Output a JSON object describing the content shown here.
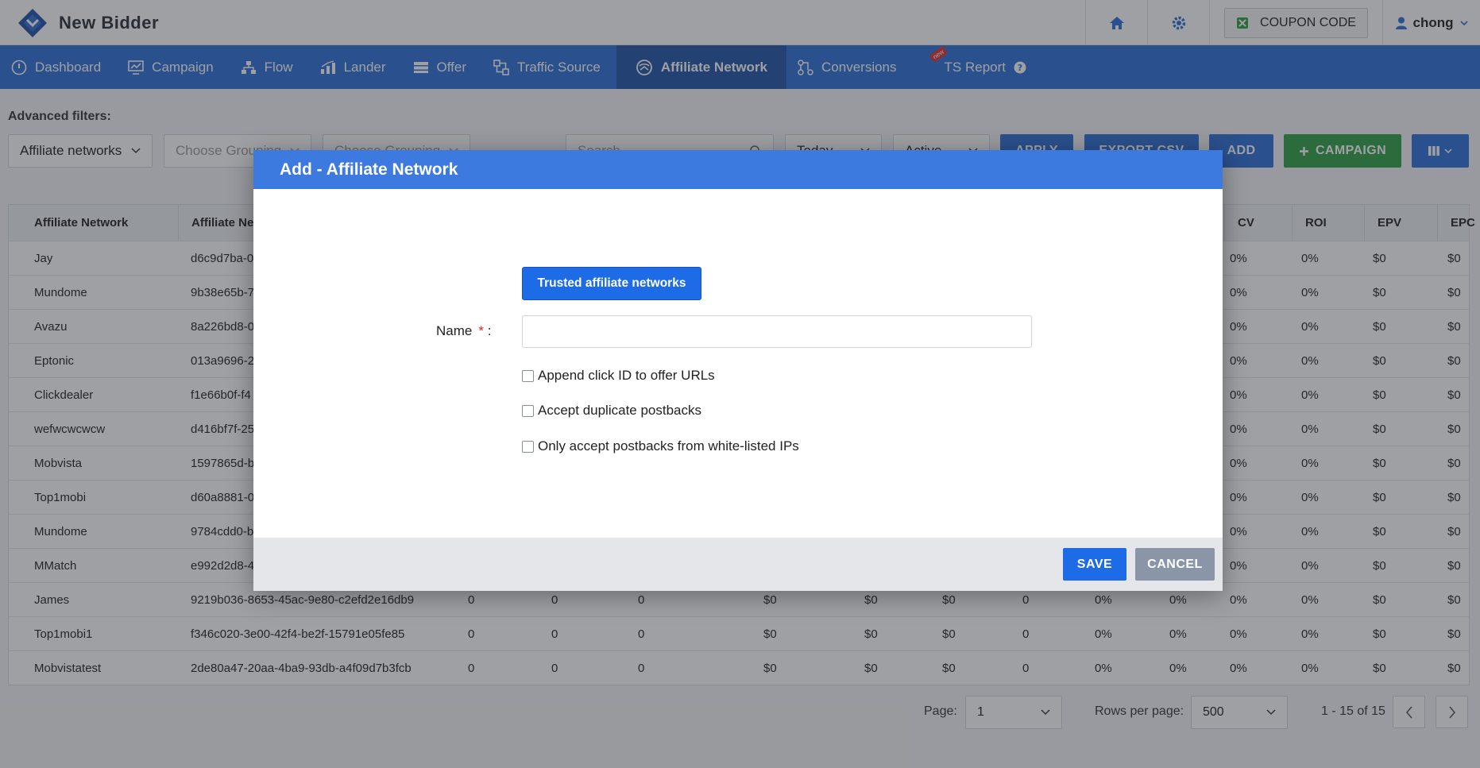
{
  "app": {
    "name": "New Bidder"
  },
  "header": {
    "coupon_label": "COUPON CODE",
    "user_name": "chong"
  },
  "nav": {
    "items": [
      {
        "label": "Dashboard"
      },
      {
        "label": "Campaign"
      },
      {
        "label": "Flow"
      },
      {
        "label": "Lander"
      },
      {
        "label": "Offer"
      },
      {
        "label": "Traffic Source"
      },
      {
        "label": "Affiliate Network"
      },
      {
        "label": "Conversions"
      },
      {
        "label": "TS Report"
      }
    ],
    "active_index": 6,
    "new_badge": "new"
  },
  "filters": {
    "label": "Advanced filters:",
    "group1": "Affiliate networks",
    "group2_placeholder": "Choose Grouping",
    "group3_placeholder": "Choose Grouping",
    "search_placeholder": "Search",
    "date_range": "Today",
    "status": "Active",
    "apply_label": "APPLY",
    "export_label": "EXPORT CSV",
    "add_label": "ADD",
    "campaign_label": "CAMPAIGN"
  },
  "table": {
    "headers": [
      "Affiliate Network",
      "Affiliate Ne",
      "CV",
      "ROI",
      "EPV",
      "EPC"
    ],
    "rows": [
      {
        "name": "Jay",
        "id": "d6c9d7ba-0"
      },
      {
        "name": "Mundome",
        "id": "9b38e65b-7"
      },
      {
        "name": "Avazu",
        "id": "8a226bd8-0"
      },
      {
        "name": "Eptonic",
        "id": "013a9696-2"
      },
      {
        "name": "Clickdealer",
        "id": "f1e66b0f-f4"
      },
      {
        "name": "wefwcwcwcw",
        "id": "d416bf7f-25"
      },
      {
        "name": "Mobvista",
        "id": "1597865d-b"
      },
      {
        "name": "Top1mobi",
        "id": "d60a8881-0"
      },
      {
        "name": "Mundome",
        "id": "9784cdd0-b"
      },
      {
        "name": "MMatch",
        "id": "e992d2d8-4"
      },
      {
        "name": "James",
        "id": "9219b036-8653-45ac-9e80-c2efd2e16db9"
      },
      {
        "name": "Top1mobi1",
        "id": "f346c020-3e00-42f4-be2f-15791e05fe85"
      },
      {
        "name": "Mobvistatest",
        "id": "2de80a47-20aa-4ba9-93db-a4f09d7b3fcb"
      }
    ],
    "full_row_values": [
      "0",
      "0",
      "0",
      "$0",
      "$0",
      "$0",
      "0",
      "0%",
      "0%"
    ],
    "tail_values": [
      "0%",
      "0%",
      "$0",
      "$0"
    ]
  },
  "pagination": {
    "page_label": "Page:",
    "page_value": "1",
    "rows_label": "Rows per page:",
    "rows_value": "500",
    "range_text": "1 - 15 of 15"
  },
  "modal": {
    "title": "Add - Affiliate Network",
    "trusted_label": "Trusted affiliate networks",
    "name_label": "Name",
    "required_mark": "*",
    "name_colon": ":",
    "name_value": "",
    "check1": "Append click ID to offer URLs",
    "check2": "Accept duplicate postbacks",
    "check3": "Only accept postbacks from white-listed IPs",
    "save_label": "SAVE",
    "cancel_label": "CANCEL"
  },
  "colors": {
    "nav_blue": "#2c6ed8",
    "nav_active": "#1f52a8",
    "modal_header": "#3d7ae0",
    "primary_button": "#1e6be8",
    "campaign_green": "#2f9e44",
    "cancel_gray": "#8a96a8"
  }
}
